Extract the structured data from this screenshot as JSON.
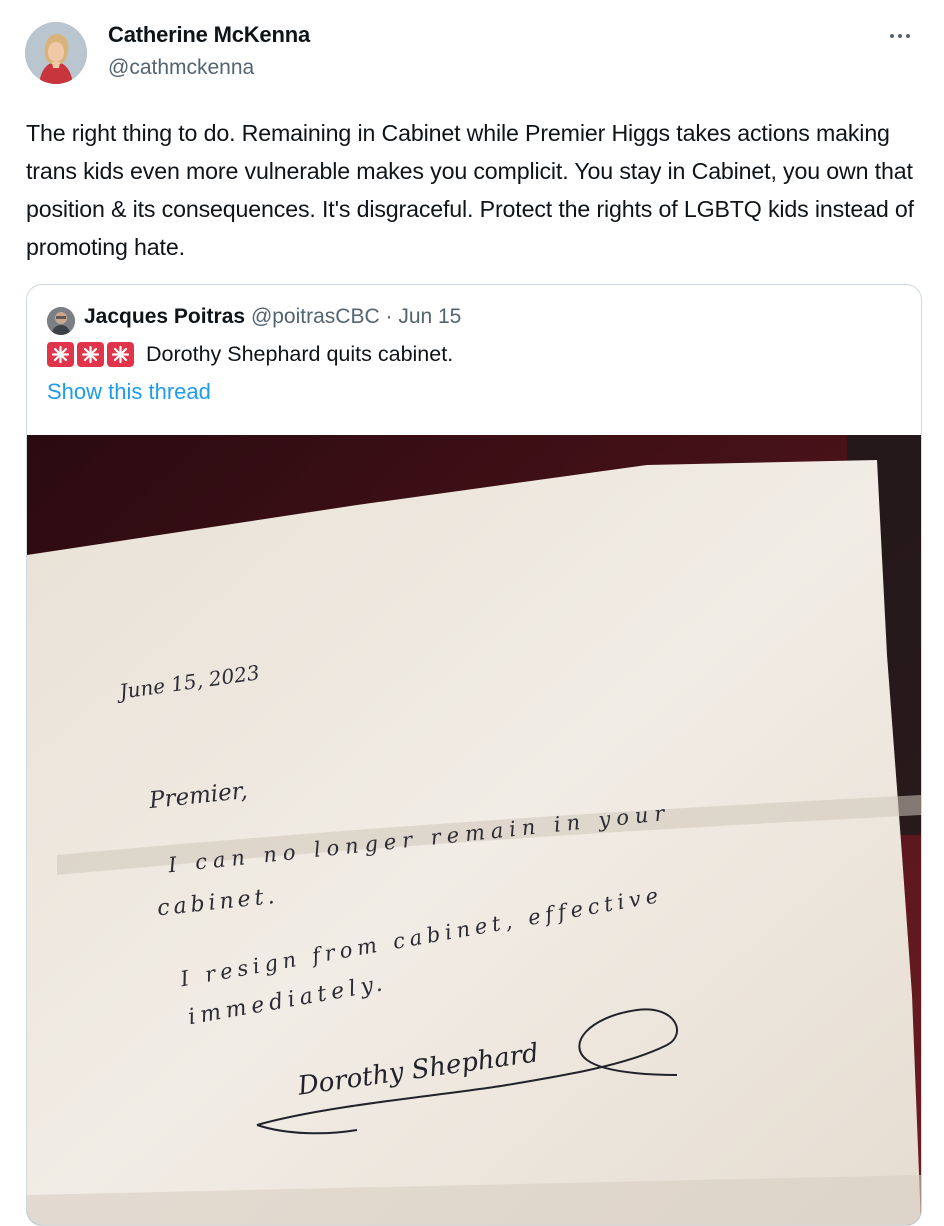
{
  "tweet": {
    "author_name": "Catherine McKenna",
    "author_handle": "@cathmckenna",
    "text": "The right thing to do. Remaining in Cabinet while Premier Higgs takes actions making trans kids even more vulnerable makes you complicit. You stay in Cabinet, you own that position & its consequences. It's disgraceful. Protect the rights of LGBTQ kids instead of promoting hate.",
    "more_icon": "more-horizontal-icon"
  },
  "quote": {
    "author_name": "Jacques Poitras",
    "author_handle": "@poitrasCBC",
    "separator": "·",
    "date": "Jun 15",
    "text": "Dorothy Shephard quits cabinet.",
    "emoji_icon": "police-light-icon",
    "emoji_count": 3,
    "show_thread": "Show this thread"
  },
  "letter": {
    "date_line": "June 15, 2023",
    "salutation": "Premier,",
    "line1": "I can no longer remain in your",
    "line2": "cabinet.",
    "line3": "I resign from cabinet, effective",
    "line4": "immediately.",
    "signature": "Dorothy Shephard"
  },
  "colors": {
    "link": "#1d9bf0",
    "secondary_text": "#536471",
    "border": "#cfd9de",
    "siren_red": "#e0344a",
    "background_cloth": "#3a0d12"
  }
}
